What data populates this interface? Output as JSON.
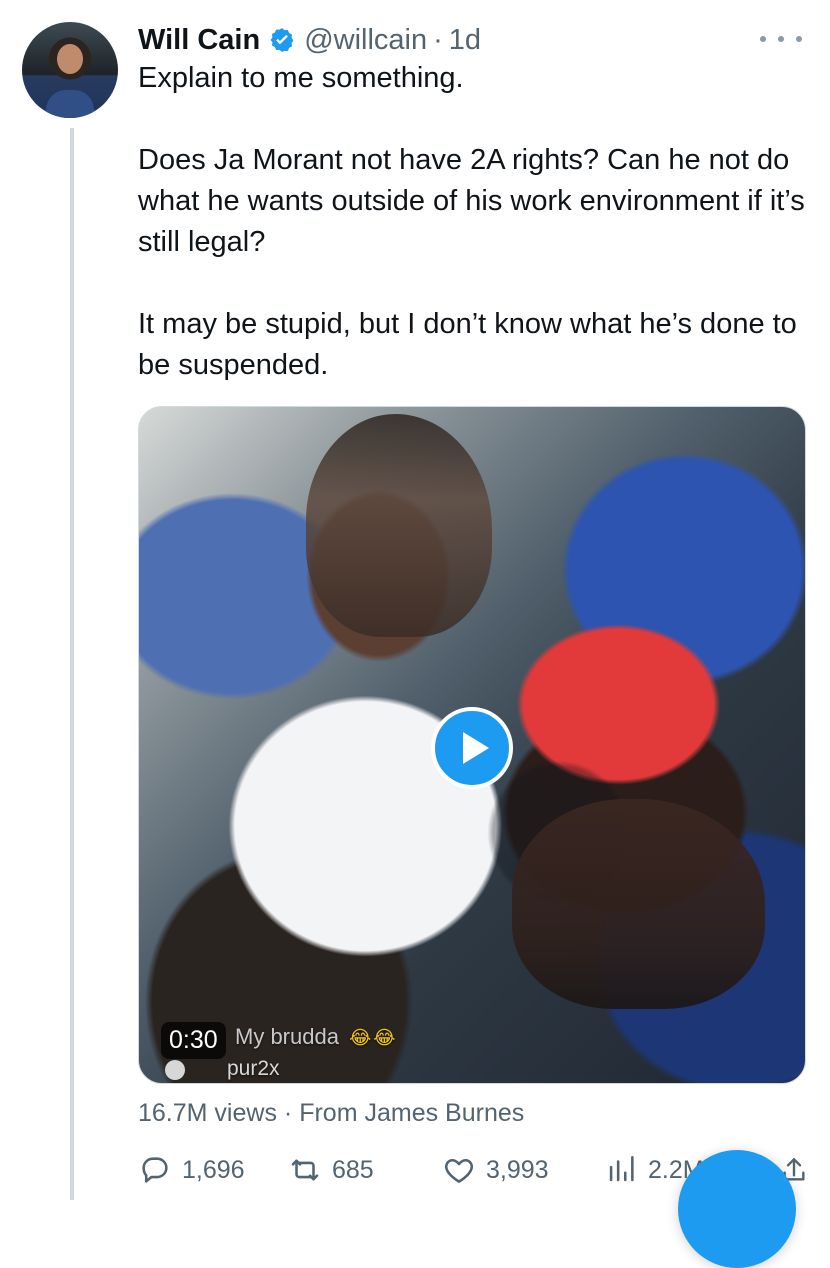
{
  "tweet": {
    "author_name": "Will Cain",
    "handle": "@willcain",
    "separator": "·",
    "time": "1d",
    "paragraphs": [
      "Explain to me something.",
      "Does Ja Morant not have 2A rights? Can he not do what he wants outside of his work environment if it’s still legal?",
      "It may be stupid, but I don’t know what he’s done to be suspended."
    ]
  },
  "media": {
    "duration": "0:30",
    "overlay_caption": "My brudda",
    "overlay_handle": "pur2x"
  },
  "meta": {
    "views": "16.7M views",
    "separator": "·",
    "source": "From James Burnes"
  },
  "actions": {
    "replies": "1,696",
    "retweets": "685",
    "likes": "3,993",
    "views": "2.2M"
  },
  "colors": {
    "accent": "#1d9bf0",
    "text": "#0f1419",
    "muted": "#536471",
    "line": "#cfd9de"
  },
  "icons": {
    "verified": "verified-badge-icon",
    "more": "more-options-icon",
    "play": "play-icon",
    "reply": "reply-icon",
    "retweet": "retweet-icon",
    "like": "heart-icon",
    "views": "views-chart-icon",
    "share": "share-icon"
  }
}
